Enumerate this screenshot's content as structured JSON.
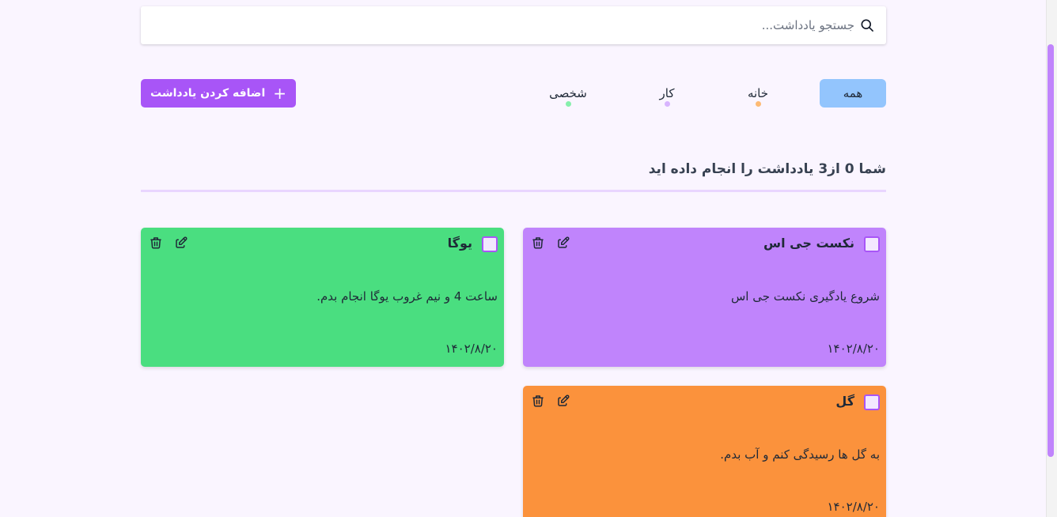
{
  "search": {
    "placeholder": "جستجو یادداشت...",
    "value": ""
  },
  "filters": {
    "all": "همه",
    "home": "خانه",
    "work": "کار",
    "personal": "شخصی",
    "home_color": "#fdba74",
    "work_color": "#d8b4fe",
    "personal_color": "#86efac",
    "active_color": "#93c5fd"
  },
  "add_button": {
    "label": "اضافه کردن یادداشت",
    "icon": "plus-icon",
    "color": "#a855f7"
  },
  "summary": "شما 0 از3 یادداشت را انجام داده اید",
  "notes": [
    {
      "title": "نکست جی اس",
      "body": "شروع یادگیری نکست جی اس",
      "date": "۱۴۰۲/۸/۲۰",
      "color": "#c084fc",
      "completed": false
    },
    {
      "title": "یوگا",
      "body": "ساعت 4 و نیم غروب یوگا انجام بدم.",
      "date": "۱۴۰۲/۸/۲۰",
      "color": "#4ade80",
      "completed": false
    },
    {
      "title": "گل",
      "body": "به گل ها رسیدگی کنم و آب بدم.",
      "date": "۱۴۰۲/۸/۲۰",
      "color": "#fb923c",
      "completed": false
    }
  ]
}
